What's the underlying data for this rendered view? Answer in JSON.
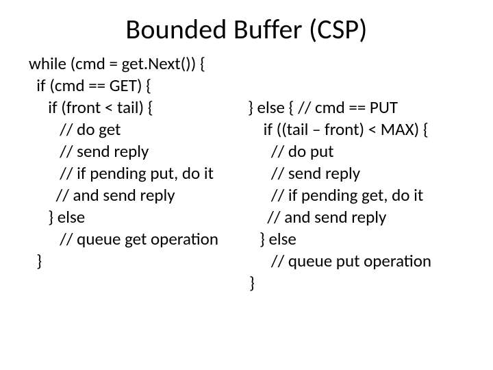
{
  "title": "Bounded Buffer (CSP)",
  "left": {
    "l1": "while (cmd = get.Next()) {",
    "l2": "  if (cmd == GET) {",
    "l3": "     if (front < tail) {",
    "l4": "        // do get",
    "l5": "        // send reply",
    "l6": "        // if pending put, do it",
    "l7": "       // and send reply",
    "l8": "     } else",
    "l9": "        // queue get operation",
    "l10": "  }"
  },
  "right": {
    "r1": "} else { // cmd == PUT",
    "r2": "    if ((tail – front) < MAX) {",
    "r3": "      // do put",
    "r4": "      // send reply",
    "r5": "      // if pending get, do it",
    "r6": "     // and send reply",
    "r7": "   } else",
    "r8": "      // queue put operation",
    "r9": "}"
  }
}
